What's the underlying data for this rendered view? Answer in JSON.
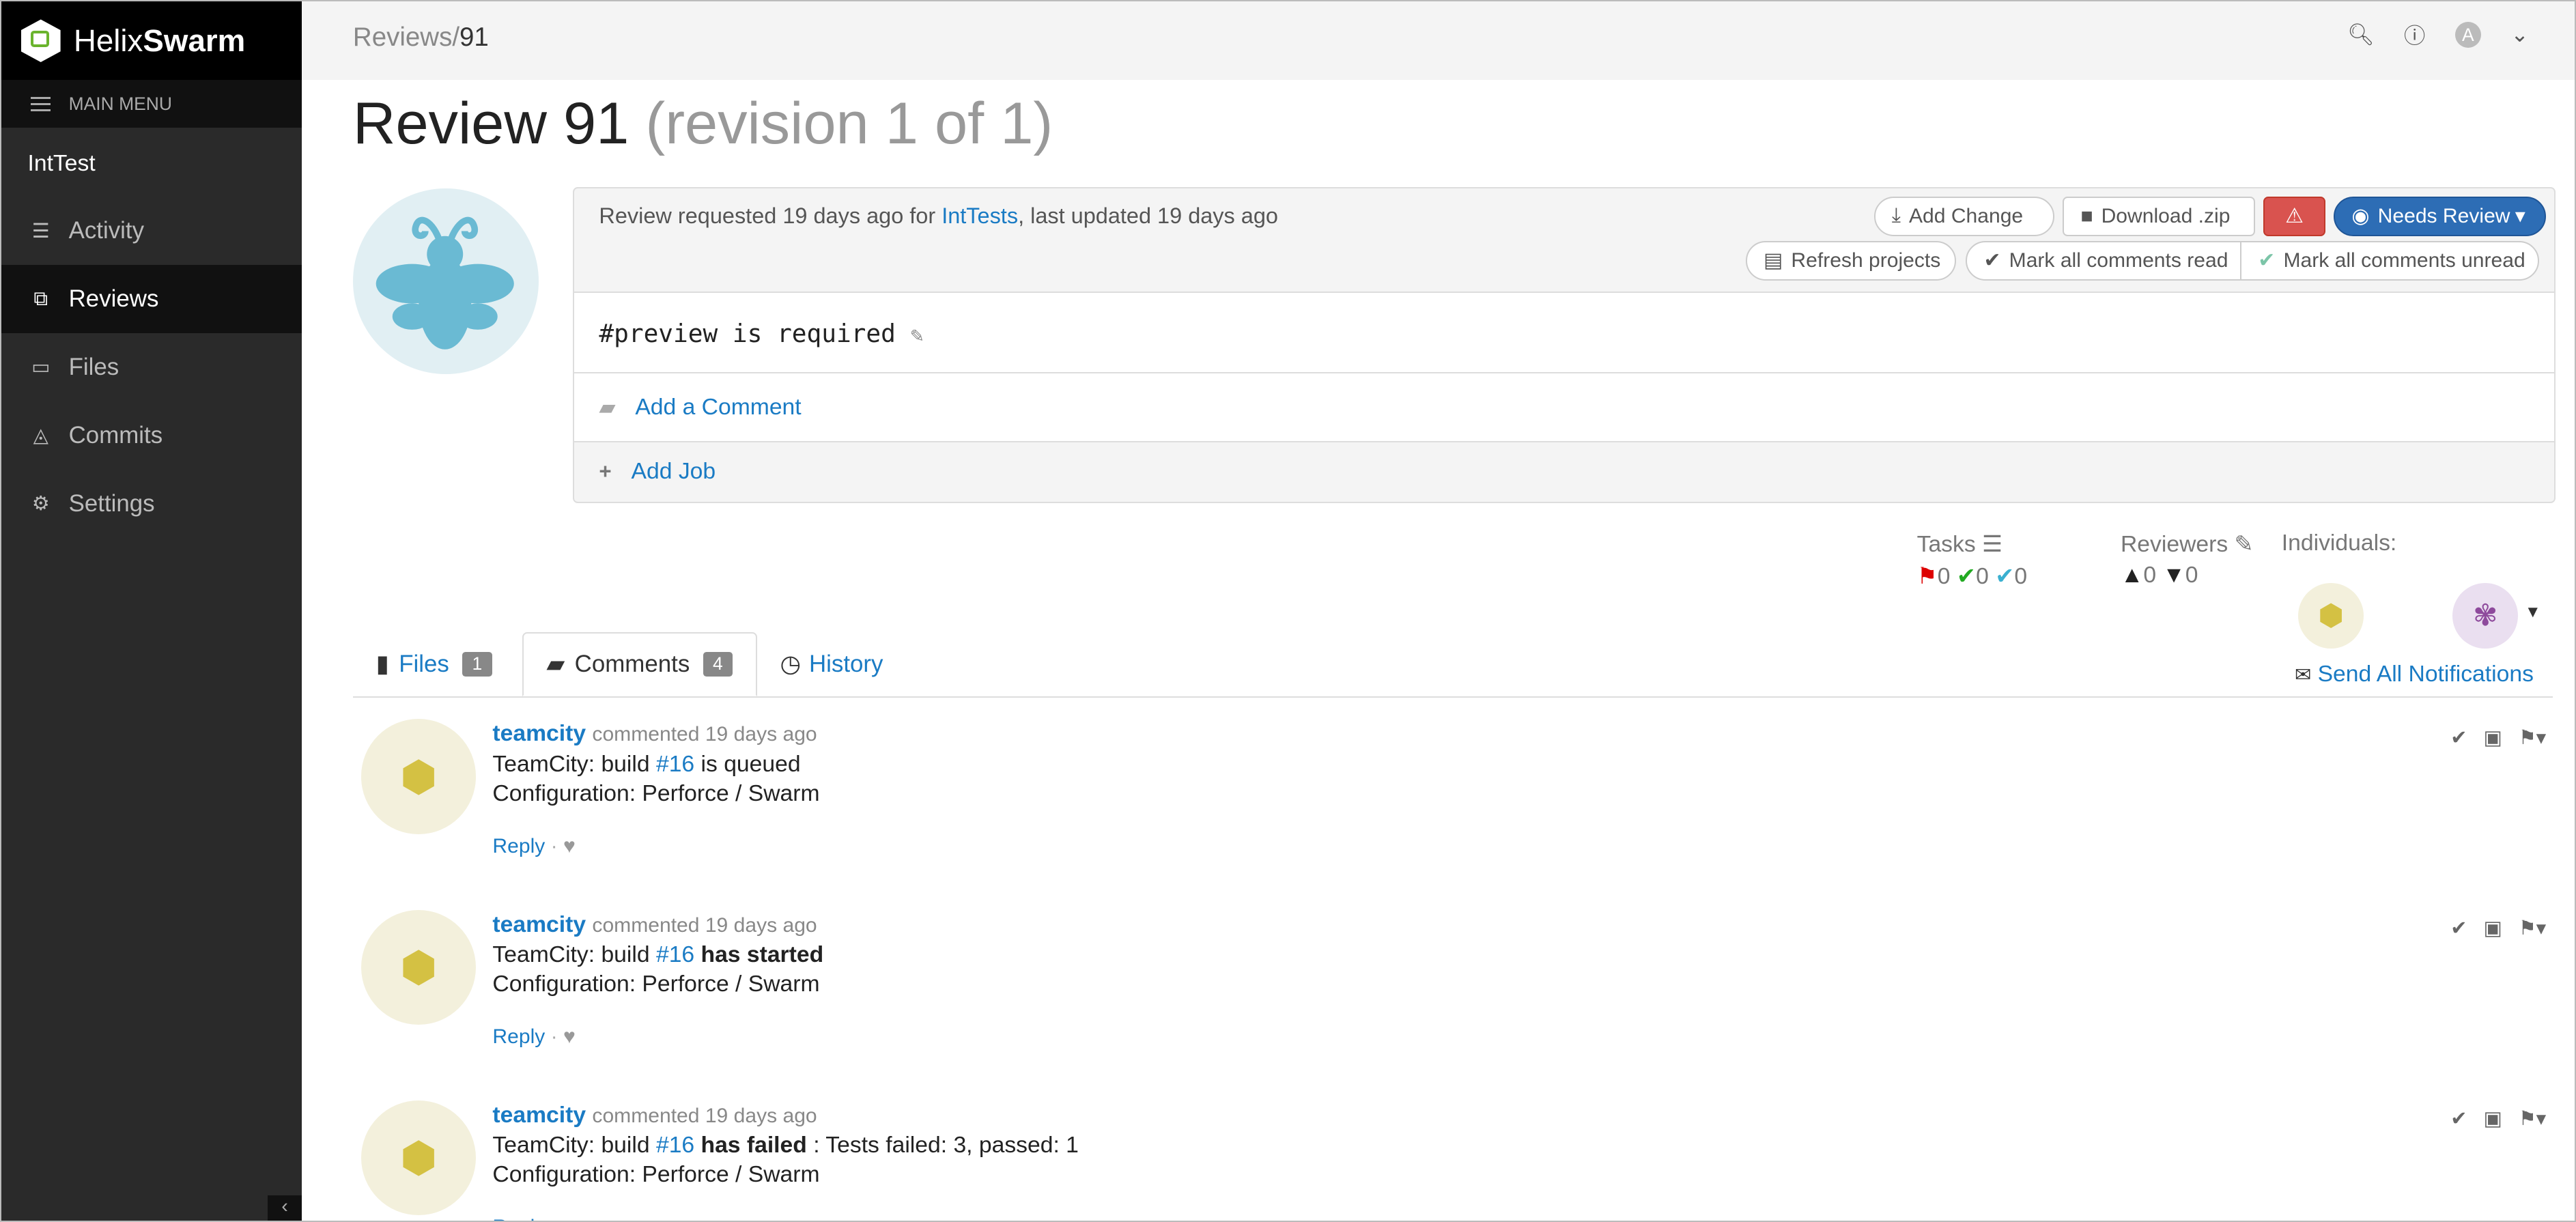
{
  "brand": {
    "name_light": "Helix",
    "name_bold": "Swarm"
  },
  "sidebar": {
    "menu_label": "MAIN MENU",
    "project": "IntTest",
    "items": [
      {
        "label": "Activity",
        "icon": "activity-icon"
      },
      {
        "label": "Reviews",
        "icon": "reviews-icon",
        "active": true
      },
      {
        "label": "Files",
        "icon": "folder-icon"
      },
      {
        "label": "Commits",
        "icon": "commits-icon"
      },
      {
        "label": "Settings",
        "icon": "gear-icon"
      }
    ]
  },
  "topbar": {
    "crumb_parent": "Reviews/",
    "crumb_current": "91",
    "avatar_letter": "A"
  },
  "review": {
    "title": "Review 91",
    "revision": "(revision 1 of 1)",
    "requested_prefix": "Review requested 19 days ago for ",
    "project_link": "IntTests",
    "requested_suffix": ", last updated 19 days ago",
    "description": "#preview is required",
    "add_comment": "Add a Comment",
    "add_job": "Add Job"
  },
  "buttons": {
    "add_change": "Add Change",
    "download": "Download .zip",
    "state": "Needs Review",
    "refresh": "Refresh projects",
    "mark_read": "Mark all comments read",
    "mark_unread": "Mark all comments unread"
  },
  "colors": {
    "state": "#2d6db5",
    "danger": "#d9534f",
    "link": "#1a7bc4"
  },
  "tasks": {
    "label": "Tasks",
    "open": "0",
    "addressed": "0",
    "verified": "0"
  },
  "reviewers": {
    "label": "Reviewers",
    "up": "0",
    "down": "0",
    "individuals_label": "Individuals:",
    "send_all": "Send All Notifications"
  },
  "tabs": [
    {
      "label": "Files",
      "count": "1"
    },
    {
      "label": "Comments",
      "count": "4"
    },
    {
      "label": "History"
    }
  ],
  "comments": [
    {
      "user": "teamcity",
      "meta": "commented 19 days ago",
      "pre": "TeamCity: build ",
      "build": "#16",
      "status": "is queued",
      "bold": false,
      "extra": "",
      "config": "Configuration: Perforce / Swarm",
      "reply": "Reply"
    },
    {
      "user": "teamcity",
      "meta": "commented 19 days ago",
      "pre": "TeamCity: build ",
      "build": "#16",
      "status": "has started",
      "bold": true,
      "extra": "",
      "config": "Configuration: Perforce / Swarm",
      "reply": "Reply"
    },
    {
      "user": "teamcity",
      "meta": "commented 19 days ago",
      "pre": "TeamCity: build ",
      "build": "#16",
      "status": "has failed",
      "bold": true,
      "extra": " : Tests failed: 3, passed: 1",
      "config": "Configuration: Perforce / Swarm",
      "reply": "Reply"
    }
  ]
}
